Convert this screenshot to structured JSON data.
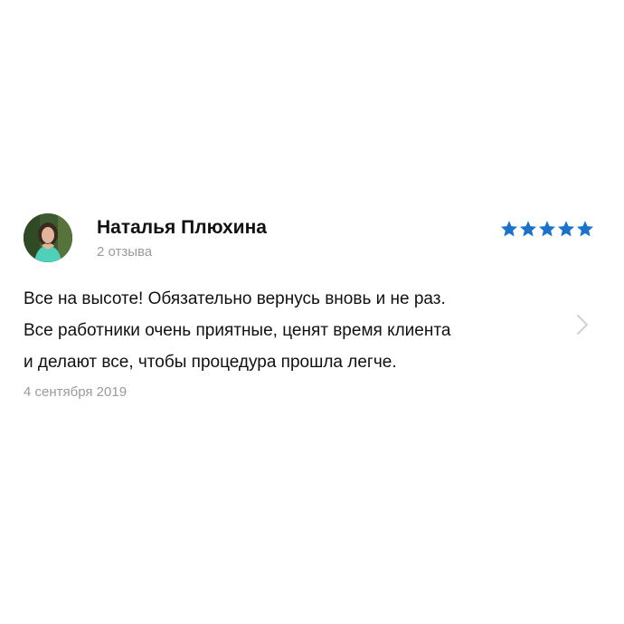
{
  "review": {
    "author": {
      "name": "Наталья Плюхина",
      "review_count": "2 отзыва",
      "avatar_icon": "user-photo-avatar"
    },
    "rating": {
      "value": 5,
      "max": 5,
      "star_color": "#1a73c8"
    },
    "text_lines": [
      "Все на высоте! Обязательно вернусь вновь и не раз.",
      "Все работники очень приятные, ценят время клиента",
      "и делают все, чтобы процедура прошла легче."
    ],
    "date": "4 сентября 2019",
    "chevron_icon": "chevron-right-icon"
  },
  "colors": {
    "background": "#ffffff",
    "text_primary": "#111111",
    "text_secondary": "#9a9a9f",
    "star": "#1a73c8",
    "chevron": "#d1d1d6"
  }
}
